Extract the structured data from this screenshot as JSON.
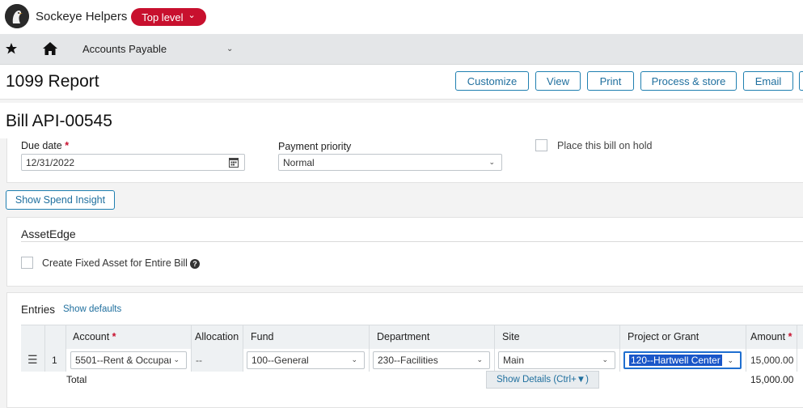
{
  "header": {
    "company": "Sockeye Helpers",
    "level_badge": "Top level",
    "level_chevron": "⌄"
  },
  "nav": {
    "module": "Accounts Payable",
    "module_chevron": "⌄"
  },
  "toolbar": {
    "title": "1099 Report",
    "buttons": [
      "Customize",
      "View",
      "Print",
      "Process & store",
      "Email"
    ]
  },
  "bill": {
    "title": "Bill API-00545"
  },
  "form": {
    "due_date_label": "Due date",
    "due_date_value": "12/31/2022",
    "payment_priority_label": "Payment priority",
    "payment_priority_value": "Normal",
    "hold_label": "Place this bill on hold",
    "required_mark": "*"
  },
  "spend_button": "Show Spend Insight",
  "asset": {
    "title": "AssetEdge",
    "checkbox_label": "Create Fixed Asset for Entire Bill",
    "help_glyph": "?"
  },
  "entries": {
    "title": "Entries",
    "show_defaults": "Show defaults",
    "columns": [
      "Account",
      "Allocation",
      "Fund",
      "Department",
      "Site",
      "Project or Grant",
      "Amount"
    ],
    "row": {
      "menu_glyph": "☰",
      "number": "1",
      "account": "5501--Rent & Occupar",
      "allocation": "--",
      "fund": "100--General",
      "department": "230--Facilities",
      "site": "Main",
      "project": "120--Hartwell Center",
      "amount": "15,000.00"
    },
    "total_label": "Total",
    "total_amount": "15,000.00",
    "show_details": "Show Details (Ctrl+▼)"
  },
  "colors": {
    "brand_red": "#c8102e",
    "link_blue": "#1f6f9e",
    "selection_blue": "#1a56c8"
  }
}
